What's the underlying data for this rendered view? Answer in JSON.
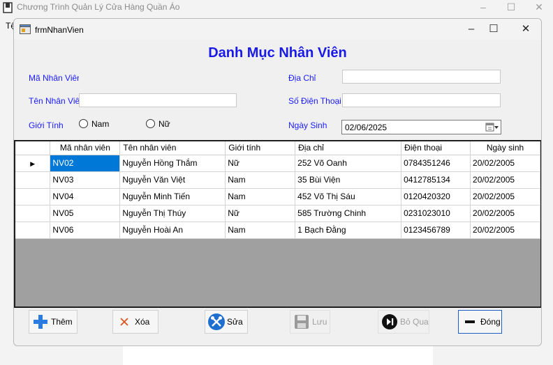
{
  "app": {
    "title": "Chương Trình Quản Lý Cửa Hàng Quần Áo",
    "menu_stub": "Tệ"
  },
  "form": {
    "title": "frmNhanVien",
    "heading": "Danh Mục Nhân Viên"
  },
  "fields": {
    "ma_nv_label": "Mã Nhân Viên",
    "ma_nv_value": "",
    "ten_nv_label": "Tên Nhân Viên",
    "ten_nv_value": "",
    "gioi_tinh_label": "Giới Tính",
    "nam_label": "Nam",
    "nu_label": "Nữ",
    "dia_chi_label": "Địa Chỉ",
    "dia_chi_value": "",
    "sdt_label": "Số Điện Thoại",
    "sdt_value": "",
    "ngay_sinh_label": "Ngày Sinh",
    "ngay_sinh_value": "02/06/2025"
  },
  "grid": {
    "columns": [
      "Mã nhân viên",
      "Tên nhân viên",
      "Giới tính",
      "Địa chỉ",
      "Điện thoại",
      "Ngày sinh"
    ],
    "rows": [
      [
        "NV02",
        "Nguyễn Hồng Thắm",
        "Nữ",
        "252 Võ Oanh",
        "0784351246",
        "20/02/2005"
      ],
      [
        "NV03",
        "Nguyễn Văn Việt",
        "Nam",
        "35 Bùi Viện",
        "0412785134",
        "20/02/2005"
      ],
      [
        "NV04",
        "Nguyễn Minh Tiến",
        "Nam",
        "452 Võ Thị Sáu",
        "0120420320",
        "20/02/2005"
      ],
      [
        "NV05",
        "Nguyễn Thị Thúy",
        "Nữ",
        "585 Trường Chinh",
        "0231023010",
        "20/02/2005"
      ],
      [
        "NV06",
        "Nguyễn Hoài An",
        "Nam",
        "1 Bạch Đằng",
        "0123456789",
        "20/02/2005"
      ]
    ],
    "selected_row": 0,
    "current_row_marker": "▶"
  },
  "buttons": {
    "them": "Thêm",
    "xoa": "Xóa",
    "sua": "Sửa",
    "luu": "Lưu",
    "bo_qua": "Bỏ Qua",
    "dong": "Đóng"
  },
  "colors": {
    "label_blue": "#1a1aff",
    "heading_blue": "#1a1ae6",
    "selection": "#0078d7"
  }
}
